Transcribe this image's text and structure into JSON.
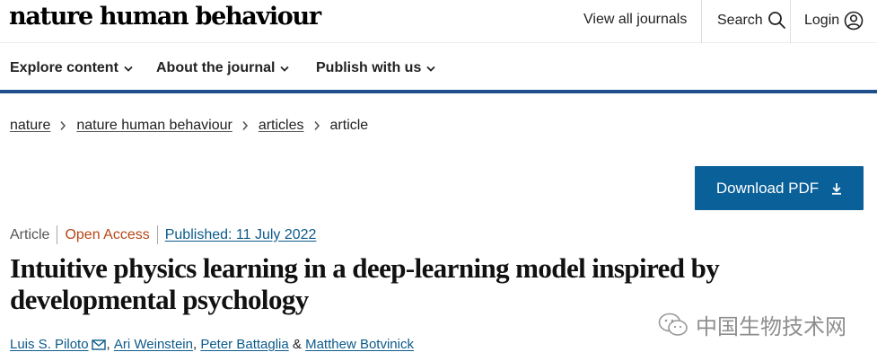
{
  "header": {
    "logo": "nature human behaviour",
    "view_all_journals": "View all journals",
    "search_label": "Search",
    "login_label": "Login"
  },
  "nav": {
    "items": [
      {
        "label": "Explore content"
      },
      {
        "label": "About the journal"
      },
      {
        "label": "Publish with us"
      }
    ],
    "accent_color": "#1f4e8c"
  },
  "breadcrumb": {
    "items": [
      "nature",
      "nature human behaviour",
      "articles"
    ],
    "current": "article"
  },
  "download": {
    "label": "Download PDF",
    "color": "#0a6098"
  },
  "article": {
    "type": "Article",
    "access": "Open Access",
    "published": "Published: 11 July 2022",
    "title": "Intuitive physics learning in a deep-learning model inspired by developmental psychology",
    "authors": [
      "Luis S. Piloto",
      "Ari Weinstein",
      "Peter Battaglia",
      "Matthew Botvinick"
    ],
    "ampersand": "&"
  },
  "watermark": {
    "text": "中国生物技术网"
  }
}
